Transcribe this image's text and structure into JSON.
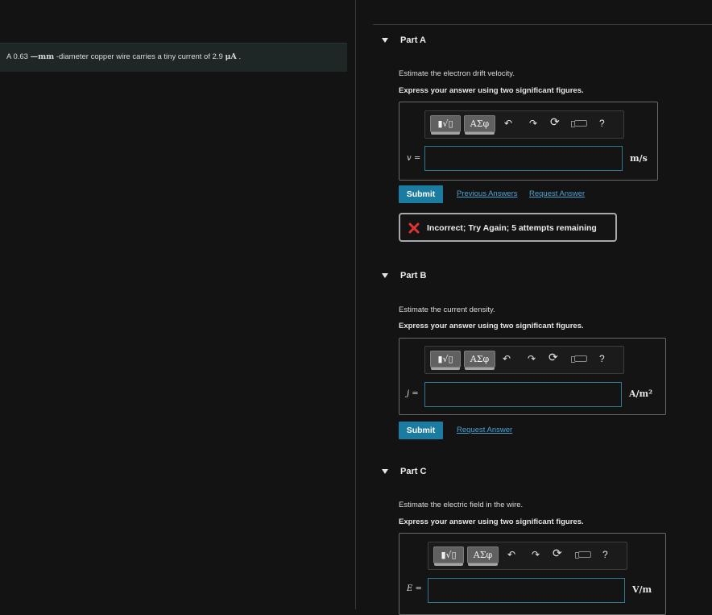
{
  "problem": {
    "prefix": "A 0.63",
    "unit_mm": "mm",
    "middle": "-diameter copper wire carries a tiny current of 2.9",
    "unit_ua": "μA",
    "suffix": "."
  },
  "toolbar": {
    "template_btn": "",
    "greek_btn": "ΑΣφ",
    "help": "?"
  },
  "parts": [
    {
      "title": "Part A",
      "question": "Estimate the electron drift velocity.",
      "instruction": "Express your answer using two significant figures.",
      "var_label": "v =",
      "input_value": "",
      "unit": "m/s",
      "submit": "Submit",
      "links": [
        "Previous Answers",
        "Request Answer"
      ],
      "feedback": "Incorrect; Try Again; 5 attempts remaining"
    },
    {
      "title": "Part B",
      "question": "Estimate the current density.",
      "instruction": "Express your answer using two significant figures.",
      "var_label": "j =",
      "input_value": "",
      "unit": "A/m²",
      "submit": "Submit",
      "links": [
        "Request Answer"
      ]
    },
    {
      "title": "Part C",
      "question": "Estimate the electric field in the wire.",
      "instruction": "Express your answer using two significant figures.",
      "var_label": "E =",
      "input_value": "",
      "unit": "V/m"
    }
  ],
  "colors": {
    "accent": "#1a7ca0",
    "link": "#4aa3d1",
    "error": "#e03434",
    "background": "#131313"
  }
}
